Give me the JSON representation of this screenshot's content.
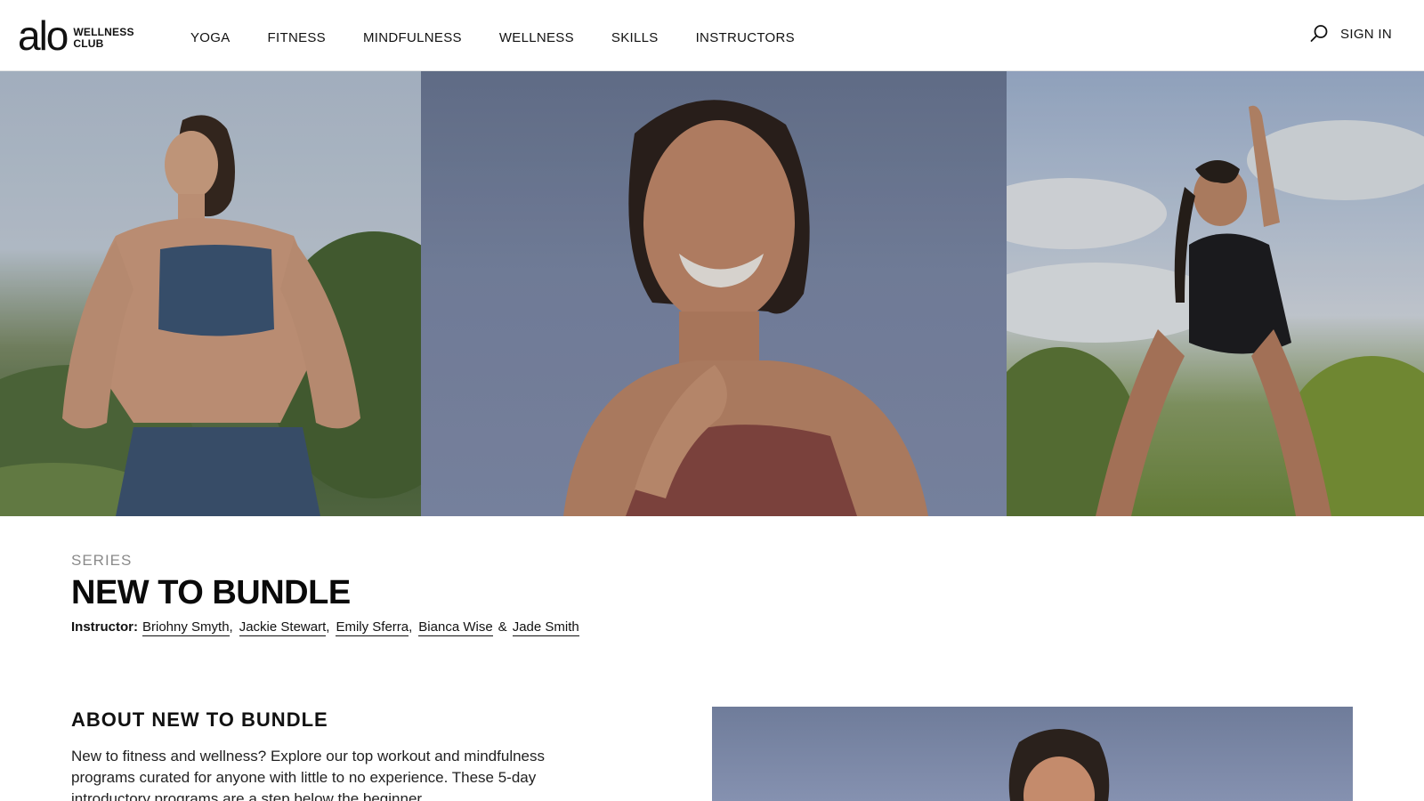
{
  "header": {
    "logo": {
      "mark": "alo",
      "line1": "WELLNESS",
      "line2": "CLUB"
    },
    "nav": [
      "YOGA",
      "FITNESS",
      "MINDFULNESS",
      "WELLNESS",
      "SKILLS",
      "INSTRUCTORS"
    ],
    "search_icon": "search-icon",
    "sign_in": "SIGN IN"
  },
  "series": {
    "label": "SERIES",
    "title": "NEW TO BUNDLE",
    "instructor_label": "Instructor:",
    "instructors": [
      "Briohny Smyth",
      "Jackie Stewart",
      "Emily Sferra",
      "Bianca Wise",
      "Jade Smith"
    ],
    "conjunction": "&"
  },
  "about": {
    "title": "ABOUT NEW TO BUNDLE",
    "text": "New to fitness and wellness? Explore our top workout and mindfulness programs curated for anyone with little to no experience. These 5-day introductory programs are a step below the beginner"
  }
}
